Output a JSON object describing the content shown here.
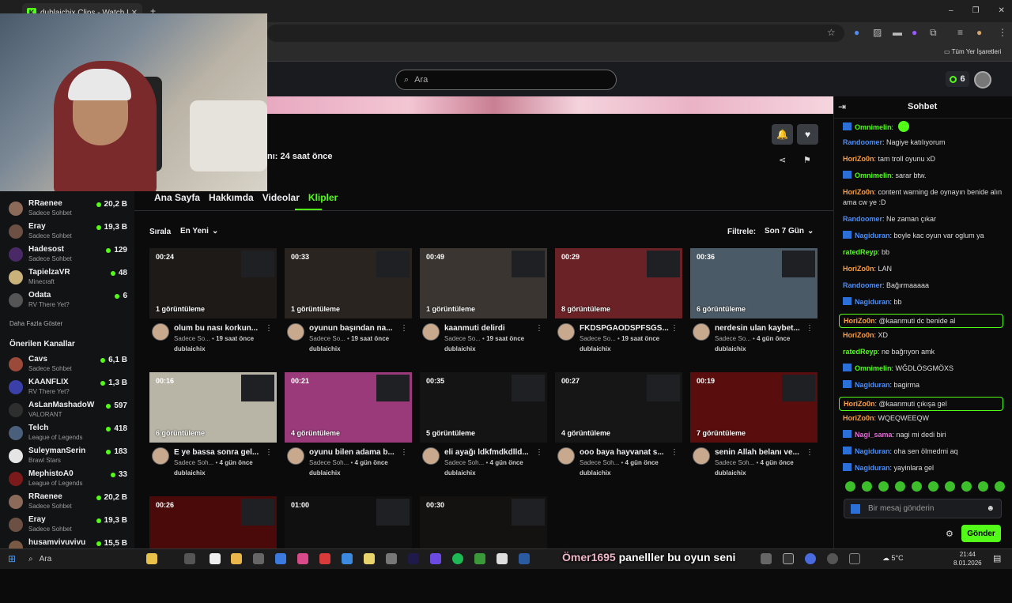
{
  "browser": {
    "tab_title": "dublaichix Clips - Watch Live on",
    "tab_favicon": "K",
    "new_tab": "+",
    "bookmarks_folder": "Tüm Yer İşaretleri",
    "window_controls": [
      "–",
      "❐",
      "✕"
    ]
  },
  "header": {
    "search_placeholder": "Ara",
    "kicks_count": "6"
  },
  "channel": {
    "last_live": "nı: 24 saat önce"
  },
  "nav_tabs": [
    "Ana Sayfa",
    "Hakkımda",
    "Videolar",
    "Klipler"
  ],
  "sort": {
    "label": "Sırala",
    "value": "En Yeni"
  },
  "filter": {
    "label": "Filtrele:",
    "value": "Son 7 Gün"
  },
  "sidebar": {
    "following": [
      {
        "name": "RRaenee",
        "category": "Sadece Sohbet",
        "viewers": "20,2 B",
        "color": "#8b6a5a"
      },
      {
        "name": "Eray",
        "category": "Sadece Sohbet",
        "viewers": "19,3 B",
        "color": "#6d5044"
      },
      {
        "name": "Hadesost",
        "category": "Sadece Sohbet",
        "viewers": "129",
        "color": "#4a2a66"
      },
      {
        "name": "TapielzaVR",
        "category": "Minecraft",
        "viewers": "48",
        "color": "#c9b37a"
      },
      {
        "name": "Odata",
        "category": "RV There Yet?",
        "viewers": "6",
        "color": "#555"
      }
    ],
    "show_more": "Daha Fazla Göster",
    "recommended_title": "Önerilen Kanallar",
    "recommended": [
      {
        "name": "Cavs",
        "category": "Sadece Sohbet",
        "viewers": "6,1 B",
        "color": "#9b4a3a"
      },
      {
        "name": "KAANFLIX",
        "category": "RV There Yet?",
        "viewers": "1,3 B",
        "color": "#3b3fa8"
      },
      {
        "name": "AsLanMashadoW",
        "category": "VALORANT",
        "viewers": "597",
        "color": "#2e2e2e"
      },
      {
        "name": "Telch",
        "category": "League of Legends",
        "viewers": "418",
        "color": "#4a5f7a"
      },
      {
        "name": "SuleymanSerin",
        "category": "Brawl Stars",
        "viewers": "183",
        "color": "#e5e5e5"
      },
      {
        "name": "MephistoA0",
        "category": "League of Legends",
        "viewers": "33",
        "color": "#7a1a1a"
      },
      {
        "name": "RRaenee",
        "category": "Sadece Sohbet",
        "viewers": "20,2 B",
        "color": "#8b6a5a"
      },
      {
        "name": "Eray",
        "category": "Sadece Sohbet",
        "viewers": "19,3 B",
        "color": "#6d5044"
      },
      {
        "name": "husamvivuvivu",
        "category": "",
        "viewers": "15,5 B",
        "color": "#7a5a44"
      }
    ]
  },
  "clips": [
    {
      "duration": "00:24",
      "views": "1 görüntüleme",
      "title": "olum bu nası korkun...",
      "meta": "Sadece So...",
      "age": "19 saat önce",
      "author": "dublaichix",
      "bg": "#1d1a18"
    },
    {
      "duration": "00:33",
      "views": "1 görüntüleme",
      "title": "oyunun başından na...",
      "meta": "Sadece So...",
      "age": "19 saat önce",
      "author": "dublaichix",
      "bg": "#2a2420"
    },
    {
      "duration": "00:49",
      "views": "1 görüntüleme",
      "title": "kaanmuti delirdi",
      "meta": "Sadece So...",
      "age": "19 saat önce",
      "author": "dublaichix",
      "bg": "#3a3530"
    },
    {
      "duration": "00:29",
      "views": "8 görüntüleme",
      "title": "FKDSPĞAODSPFSĞS...",
      "meta": "Sadece So...",
      "age": "19 saat önce",
      "author": "dublaichix",
      "bg": "#6a2226"
    },
    {
      "duration": "00:36",
      "views": "6 görüntüleme",
      "title": "nerdesin ulan kaybet...",
      "meta": "Sadece So...",
      "age": "4 gün önce",
      "author": "dublaichix",
      "bg": "#4a5a66"
    },
    {
      "duration": "00:16",
      "views": "6 görüntüleme",
      "title": "E ye bassa sonra gel...",
      "meta": "Sadece Soh...",
      "age": "4 gün önce",
      "author": "dublaichix",
      "bg": "#b8b4a6"
    },
    {
      "duration": "00:21",
      "views": "4 görüntüleme",
      "title": "oyunu bilen adama b...",
      "meta": "Sadece Soh...",
      "age": "4 gün önce",
      "author": "dublaichix",
      "bg": "#9a3a7a"
    },
    {
      "duration": "00:35",
      "views": "5 görüntüleme",
      "title": "eli ayağı ldkfmdkdlld...",
      "meta": "Sadece Soh...",
      "age": "4 gün önce",
      "author": "dublaichix",
      "bg": "#141414"
    },
    {
      "duration": "00:27",
      "views": "4 görüntüleme",
      "title": "ooo baya hayvanat s...",
      "meta": "Sadece Soh...",
      "age": "4 gün önce",
      "author": "dublaichix",
      "bg": "#161616"
    },
    {
      "duration": "00:19",
      "views": "7 görüntüleme",
      "title": "senin Allah belanı ve...",
      "meta": "Sadece Soh...",
      "age": "4 gün önce",
      "author": "dublaichix",
      "bg": "#5a0d0d"
    },
    {
      "duration": "00:26",
      "views": "",
      "title": "",
      "meta": "",
      "age": "",
      "author": "",
      "bg": "#4a0a0a"
    },
    {
      "duration": "01:00",
      "views": "",
      "title": "",
      "meta": "",
      "age": "",
      "author": "",
      "bg": "#101010"
    },
    {
      "duration": "00:30",
      "views": "",
      "title": "",
      "meta": "",
      "age": "",
      "author": "",
      "bg": "#141210"
    }
  ],
  "chat": {
    "title": "Sohbet",
    "messages": [
      {
        "user": "Omnimelin",
        "text": "",
        "color": "#53fc18",
        "badge": true,
        "emote": true,
        "hl": false
      },
      {
        "user": "Randoomer",
        "text": "Nagiye katılıyorum",
        "color": "#4c8df6",
        "badge": false,
        "emote": false,
        "hl": false
      },
      {
        "user": "HoriZo0n",
        "text": "tam troll oyunu xD",
        "color": "#ff9f43",
        "badge": false,
        "emote": false,
        "hl": false
      },
      {
        "user": "Omnimelin",
        "text": "sarar btw.",
        "color": "#53fc18",
        "badge": true,
        "emote": false,
        "hl": false
      },
      {
        "user": "HoriZo0n",
        "text": "content warning de oynayın benide alın ama cw ye :D",
        "color": "#ff9f43",
        "badge": false,
        "emote": false,
        "hl": false
      },
      {
        "user": "Randoomer",
        "text": "Ne zaman çıkar",
        "color": "#4c8df6",
        "badge": false,
        "emote": false,
        "hl": false
      },
      {
        "user": "Nagiduran",
        "text": "boyle kac oyun var oglum ya",
        "color": "#4c8df6",
        "badge": true,
        "emote": false,
        "hl": false
      },
      {
        "user": "ratedReyp",
        "text": "bb",
        "color": "#53fc18",
        "badge": false,
        "emote": false,
        "hl": false
      },
      {
        "user": "HoriZo0n",
        "text": "LAN",
        "color": "#ff9f43",
        "badge": false,
        "emote": false,
        "hl": false
      },
      {
        "user": "Randoomer",
        "text": "Bağırmaaaaa",
        "color": "#4c8df6",
        "badge": false,
        "emote": false,
        "hl": false
      },
      {
        "user": "Nagiduran",
        "text": "bb",
        "color": "#4c8df6",
        "badge": true,
        "emote": false,
        "hl": false
      },
      {
        "user": "HoriZo0n",
        "text": "@kaanmuti dc benide al",
        "color": "#ff9f43",
        "badge": false,
        "emote": false,
        "hl": true
      },
      {
        "user": "HoriZo0n",
        "text": "XD",
        "color": "#ff9f43",
        "badge": false,
        "emote": false,
        "hl": false
      },
      {
        "user": "ratedReyp",
        "text": "ne bağrıyon amk",
        "color": "#53fc18",
        "badge": false,
        "emote": false,
        "hl": false
      },
      {
        "user": "Omnimelin",
        "text": "WĞDLÖSGMÖXS",
        "color": "#53fc18",
        "badge": true,
        "emote": false,
        "hl": false
      },
      {
        "user": "Nagiduran",
        "text": "bagirma",
        "color": "#4c8df6",
        "badge": true,
        "emote": false,
        "hl": false
      },
      {
        "user": "HoriZo0n",
        "text": "@kaanmuti çıkışa gel",
        "color": "#ff9f43",
        "badge": false,
        "emote": false,
        "hl": true
      },
      {
        "user": "HoriZo0n",
        "text": "WQEQWEEQW",
        "color": "#ff9f43",
        "badge": false,
        "emote": false,
        "hl": false
      },
      {
        "user": "Nagi_sama",
        "text": "nagi mi dedi biri",
        "color": "#e36bd6",
        "badge": true,
        "emote": false,
        "hl": false
      },
      {
        "user": "Nagiduran",
        "text": "oha sen ölmedmi aq",
        "color": "#4c8df6",
        "badge": true,
        "emote": false,
        "hl": false
      },
      {
        "user": "Nagiduran",
        "text": "yayinlara gel",
        "color": "#4c8df6",
        "badge": true,
        "emote": false,
        "hl": false
      }
    ],
    "input_placeholder": "Bir mesaj gönderin",
    "send_label": "Gönder"
  },
  "taskbar": {
    "search": "Ara",
    "overlay_a": "Ömer1695",
    "overlay_b": "panelller bu oyun seni",
    "weather": "5°C",
    "time": "21:44",
    "date": "8.01.2026"
  }
}
